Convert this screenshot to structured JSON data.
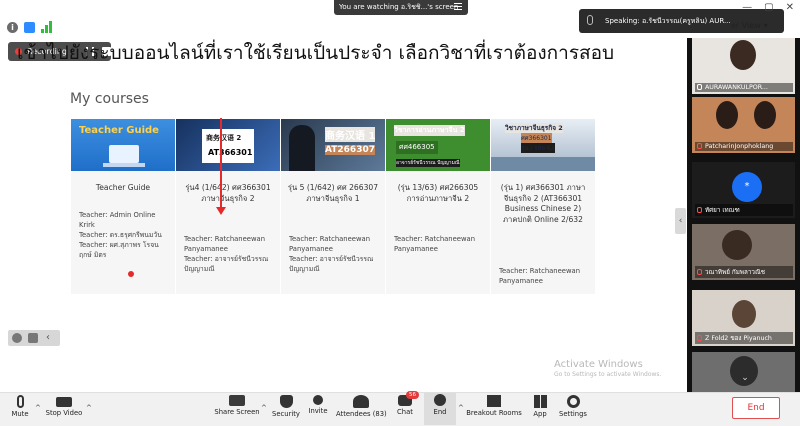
{
  "topbar": {
    "watching": "You are watching อ.ริชชิ...'s screen",
    "speaking": "Speaking: อ.รัชนีวรรณ(ครูหลิน) AUR...",
    "view": "er View",
    "view_chevron": "▾",
    "window_buttons": [
      "—",
      "▢",
      "✕"
    ]
  },
  "recording": {
    "label": "Recording"
  },
  "slide": {
    "heading": "เข้าไปยังระบบออนไลน์ที่เราใช้เรียนเป็นประจำ เลือกวิชาที่เราต้องการสอบ",
    "my_courses": "My courses",
    "courses": [
      {
        "thumb": {
          "title": "Teacher Guide"
        },
        "title": "Teacher Guide",
        "teachers": [
          "Teacher: Admin Online Krirk",
          "Teacher: ดร.ธรุศกรีพนมวัน",
          "Teacher: ผศ.สุภาพร โรจนฤกษ์ มิตร"
        ]
      },
      {
        "thumb": {
          "title": "商务汉语 2",
          "code": "AT366301"
        },
        "title": "รุ่น4 (1/642) ศศ366301 ภาษาจีนธุรกิจ 2",
        "teachers": [
          "Teacher: Ratchaneewan Panyamanee",
          "Teacher: อาจารย์รัชนีวรรณ ปัญญามณี"
        ]
      },
      {
        "thumb": {
          "title": "商务汉语 1",
          "code": "AT266307"
        },
        "title": "รุ่น 5 (1/642) ศศ 266307 ภาษาจีนธุรกิจ 1",
        "teachers": [
          "Teacher: Ratchaneewan Panyamanee",
          "Teacher: อาจารย์รัชนีวรรณ ปัญญามณี"
        ]
      },
      {
        "thumb": {
          "title": "วิชาการอ่านภาษาจีน 2",
          "code": "ศศ466305",
          "sub": "อาจารย์รัชนีวรรณ ปัญญามณี"
        },
        "title": "(รุ่น 13/63) ศศ266305 การอ่านภาษาจีน 2",
        "teachers": [
          "Teacher: Ratchaneewan Panyamanee"
        ]
      },
      {
        "thumb": {
          "title": "วิชาภาษาจีนธุรกิจ 2",
          "code": "ศศ366301",
          "sub": "รุ่น / รหัส 63"
        },
        "title": "(รุ่น 1) ศศ366301 ภาษาจีนธุรกิจ 2 (AT366301 Business Chinese 2) ภาคปกติ Online 2/632",
        "teachers": [
          "Teacher: Ratchaneewan Panyamanee"
        ]
      }
    ],
    "watermark_title": "Activate Windows",
    "watermark_sub": "Go to Settings to activate Windows."
  },
  "annotate": {
    "more": "‹"
  },
  "collapse": "‹",
  "gallery": {
    "tiles": [
      {
        "name": "AURAWANKULPOR..."
      },
      {
        "name": "PatcharinJonphoklang"
      },
      {
        "name": "ทัศยา เทณฑ",
        "avatar": "*"
      },
      {
        "name": "วณาทิพย์ กัมพลาวณิช"
      },
      {
        "name": "Z Fold2 ของ Piyanuch"
      },
      {
        "name": ""
      }
    ],
    "scroll": "⌄"
  },
  "toolbar": {
    "mute": "Mute",
    "stop_video": "Stop Video",
    "share_screen": "Share Screen",
    "security": "Security",
    "invite": "Invite",
    "attendees": "Attendees (83)",
    "chat": "Chat",
    "chat_badge": "56",
    "end": "End",
    "breakout_rooms": "Breakout Rooms",
    "app": "App",
    "settings": "Settings",
    "chevron": "^",
    "end_button": "End"
  }
}
